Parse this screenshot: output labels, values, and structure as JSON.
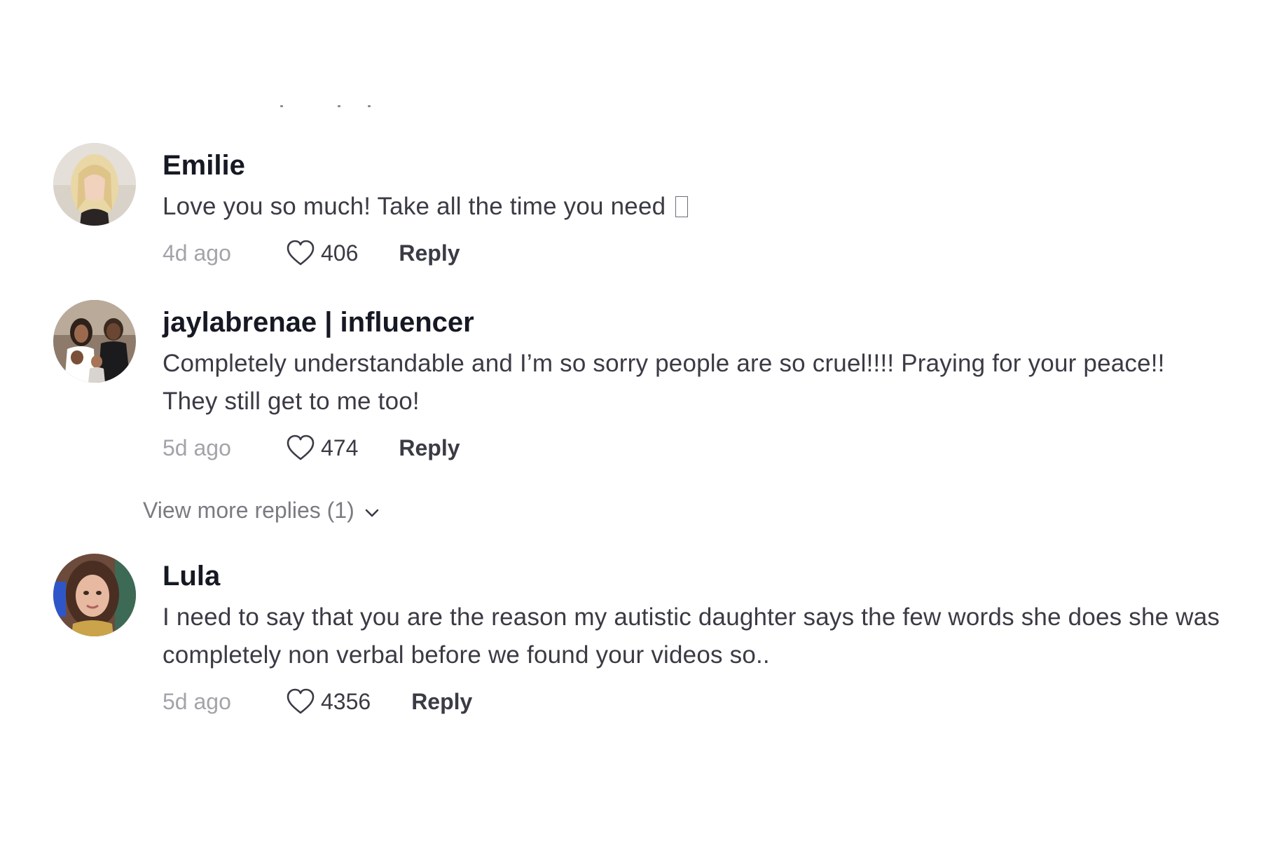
{
  "comments": [
    {
      "username": "Emilie",
      "text": "Love you so much! Take all the time you need",
      "time": "4d ago",
      "likes": "406",
      "reply_label": "Reply"
    },
    {
      "username": "jaylabrenae | influencer",
      "text": "Completely understandable and I’m so sorry people are so cruel!!!! Praying for your peace!! They still get to me too!",
      "time": "5d ago",
      "likes": "474",
      "reply_label": "Reply",
      "view_more": "View more replies (1)"
    },
    {
      "username": "Lula",
      "text": "I need to say that you are the reason my autistic daughter says the few words she does she was completely non verbal before we found your videos so..",
      "time": "5d ago",
      "likes": "4356",
      "reply_label": "Reply"
    }
  ],
  "icons": {
    "like": "heart-outline-icon",
    "expand": "chevron-down-icon",
    "missing_glyph": "missing-glyph-box"
  },
  "colors": {
    "username": "#161823",
    "text": "#3a3b44",
    "time": "#a3a4aa",
    "view_more": "#7a7b82"
  }
}
